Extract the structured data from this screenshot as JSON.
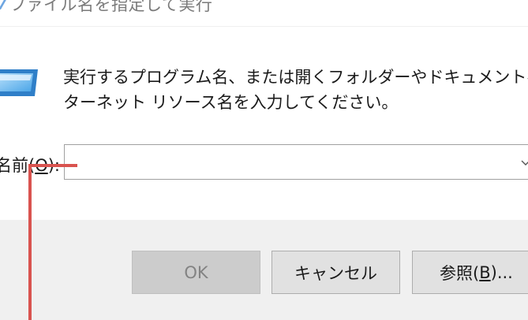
{
  "window": {
    "title": "ファイル名を指定して実行"
  },
  "description": {
    "line1": "実行するプログラム名、または開くフォルダーやドキュメント名、イン",
    "line2": "ターネット リソース名を入力してください。"
  },
  "name_field": {
    "label_prefix": "名前(",
    "label_accel": "O",
    "label_suffix": "):",
    "value": "",
    "dropdown_icon": "chevron-down-icon"
  },
  "buttons": {
    "ok_label": "OK",
    "ok_enabled": false,
    "cancel_label": "キャンセル",
    "browse_prefix": "参照(",
    "browse_accel": "B",
    "browse_suffix": ")..."
  },
  "colors": {
    "annotation": "#d9534f",
    "footer_bg": "#f0f0f0",
    "ok_disabled_text": "#838383"
  }
}
